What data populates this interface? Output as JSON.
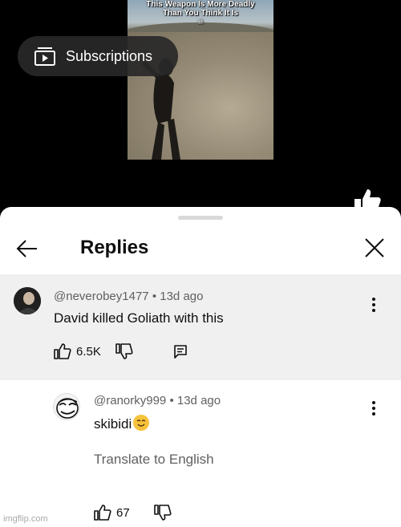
{
  "video": {
    "caption_line1": "This Weapon Is More Deadly",
    "caption_line2": "Than You Think It Is"
  },
  "subscriptions_pill": {
    "label": "Subscriptions",
    "icon": "subscriptions-icon"
  },
  "sheet": {
    "title": "Replies",
    "back_icon": "back-arrow-icon",
    "close_icon": "close-icon"
  },
  "parent_comment": {
    "handle": "@neverobey1477",
    "time": "13d ago",
    "text": "David killed Goliath with this",
    "likes": "6.5K"
  },
  "reply_comment": {
    "handle": "@ranorky999",
    "time": "13d ago",
    "text": "skibidi",
    "translate_label": "Translate to English",
    "likes": "67"
  },
  "watermark": "imgflip.com",
  "colors": {
    "sheet_bg": "#ffffff",
    "highlight_bg": "#f0f0f0",
    "secondary_text": "#606060"
  }
}
